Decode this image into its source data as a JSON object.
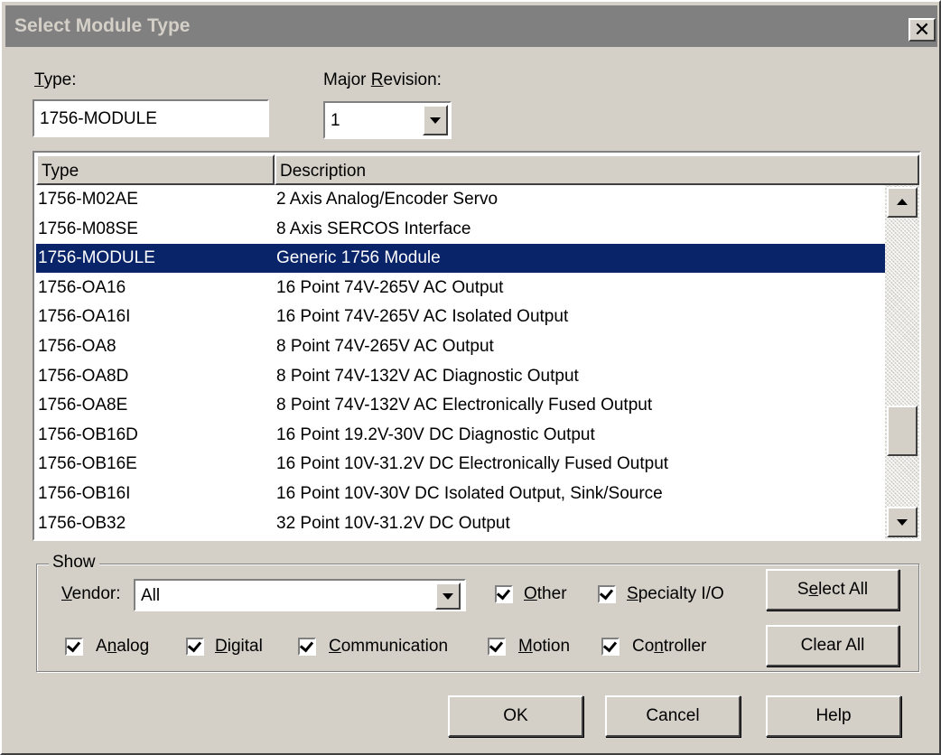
{
  "window": {
    "title": "Select Module Type"
  },
  "type_field": {
    "label_accel": "T",
    "label_rest": "ype:",
    "value": "1756-MODULE"
  },
  "revision": {
    "label_pre": "Major ",
    "label_accel": "R",
    "label_rest": "evision:",
    "value": "1"
  },
  "list": {
    "columns": [
      "Type",
      "Description"
    ],
    "selected_index": 2,
    "rows": [
      {
        "type": "1756-M02AE",
        "description": "2 Axis Analog/Encoder Servo"
      },
      {
        "type": "1756-M08SE",
        "description": "8 Axis SERCOS Interface"
      },
      {
        "type": "1756-MODULE",
        "description": "Generic 1756 Module"
      },
      {
        "type": "1756-OA16",
        "description": "16 Point 74V-265V AC Output"
      },
      {
        "type": "1756-OA16I",
        "description": "16 Point 74V-265V AC Isolated Output"
      },
      {
        "type": "1756-OA8",
        "description": "8 Point 74V-265V AC Output"
      },
      {
        "type": "1756-OA8D",
        "description": "8 Point 74V-132V AC Diagnostic Output"
      },
      {
        "type": "1756-OA8E",
        "description": "8 Point 74V-132V AC Electronically Fused Output"
      },
      {
        "type": "1756-OB16D",
        "description": "16 Point 19.2V-30V DC Diagnostic Output"
      },
      {
        "type": "1756-OB16E",
        "description": "16 Point 10V-31.2V DC Electronically Fused Output"
      },
      {
        "type": "1756-OB16I",
        "description": "16 Point 10V-30V DC Isolated Output, Sink/Source"
      },
      {
        "type": "1756-OB32",
        "description": "32 Point 10V-31.2V DC Output"
      }
    ]
  },
  "show": {
    "title": "Show",
    "vendor_label_accel": "V",
    "vendor_label_rest": "endor:",
    "vendor_value": "All",
    "filters": {
      "other": {
        "accel": "O",
        "rest": "ther",
        "checked": true
      },
      "specialty": {
        "accel": "S",
        "rest": "pecialty I/O",
        "checked": true
      },
      "analog": {
        "pre": "A",
        "accel": "n",
        "rest": "alog",
        "checked": true
      },
      "digital": {
        "accel": "D",
        "rest": "igital",
        "checked": true
      },
      "communication": {
        "accel": "C",
        "rest": "ommunication",
        "checked": true
      },
      "motion": {
        "accel": "M",
        "rest": "otion",
        "checked": true
      },
      "controller": {
        "pre": "Co",
        "accel": "n",
        "rest": "troller",
        "checked": true
      }
    },
    "select_all": {
      "pre": "S",
      "accel": "e",
      "rest": "lect All"
    },
    "clear_all": "Clear All"
  },
  "buttons": {
    "ok": "OK",
    "cancel": "Cancel",
    "help": "Help"
  }
}
